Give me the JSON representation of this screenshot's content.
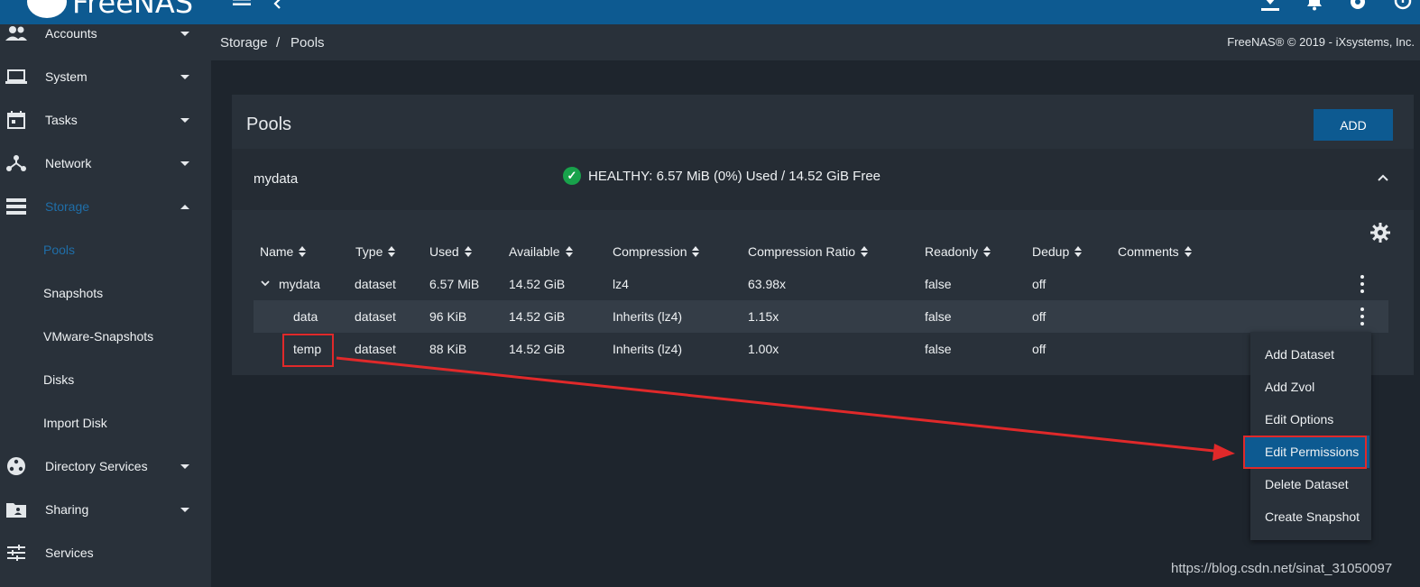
{
  "app": {
    "logo_text": "FreeNAS"
  },
  "breadcrumb": {
    "parent": "Storage",
    "separator": "/",
    "current": "Pools"
  },
  "footer": {
    "copyright": "FreeNAS® © 2019 - iXsystems, Inc."
  },
  "sidebar": {
    "items": [
      {
        "label": "Accounts"
      },
      {
        "label": "System"
      },
      {
        "label": "Tasks"
      },
      {
        "label": "Network"
      },
      {
        "label": "Storage"
      },
      {
        "label": "Directory Services"
      },
      {
        "label": "Sharing"
      },
      {
        "label": "Services"
      }
    ],
    "storage_sub": [
      {
        "label": "Pools"
      },
      {
        "label": "Snapshots"
      },
      {
        "label": "VMware-Snapshots"
      },
      {
        "label": "Disks"
      },
      {
        "label": "Import Disk"
      }
    ]
  },
  "pools_card": {
    "title": "Pools",
    "add_label": "ADD",
    "pool_name": "mydata",
    "status": "HEALTHY: 6.57 MiB (0%) Used / 14.52 GiB Free"
  },
  "table": {
    "headers": [
      "Name",
      "Type",
      "Used",
      "Available",
      "Compression",
      "Compression Ratio",
      "Readonly",
      "Dedup",
      "Comments"
    ],
    "rows": [
      {
        "name": "mydata",
        "type": "dataset",
        "used": "6.57 MiB",
        "available": "14.52 GiB",
        "compression": "lz4",
        "ratio": "63.98x",
        "readonly": "false",
        "dedup": "off"
      },
      {
        "name": "data",
        "type": "dataset",
        "used": "96 KiB",
        "available": "14.52 GiB",
        "compression": "Inherits (lz4)",
        "ratio": "1.15x",
        "readonly": "false",
        "dedup": "off"
      },
      {
        "name": "temp",
        "type": "dataset",
        "used": "88 KiB",
        "available": "14.52 GiB",
        "compression": "Inherits (lz4)",
        "ratio": "1.00x",
        "readonly": "false",
        "dedup": "off"
      }
    ]
  },
  "context_menu": {
    "items": [
      "Add Dataset",
      "Add Zvol",
      "Edit Options",
      "Edit Permissions",
      "Delete Dataset",
      "Create Snapshot"
    ],
    "highlighted": "Edit Permissions"
  },
  "watermark": "https://blog.csdn.net/sinat_31050097",
  "colors": {
    "accent": "#0d5a91",
    "active_link": "#1f6ea8",
    "healthy": "#18a24b",
    "annotation": "#e0292a"
  }
}
